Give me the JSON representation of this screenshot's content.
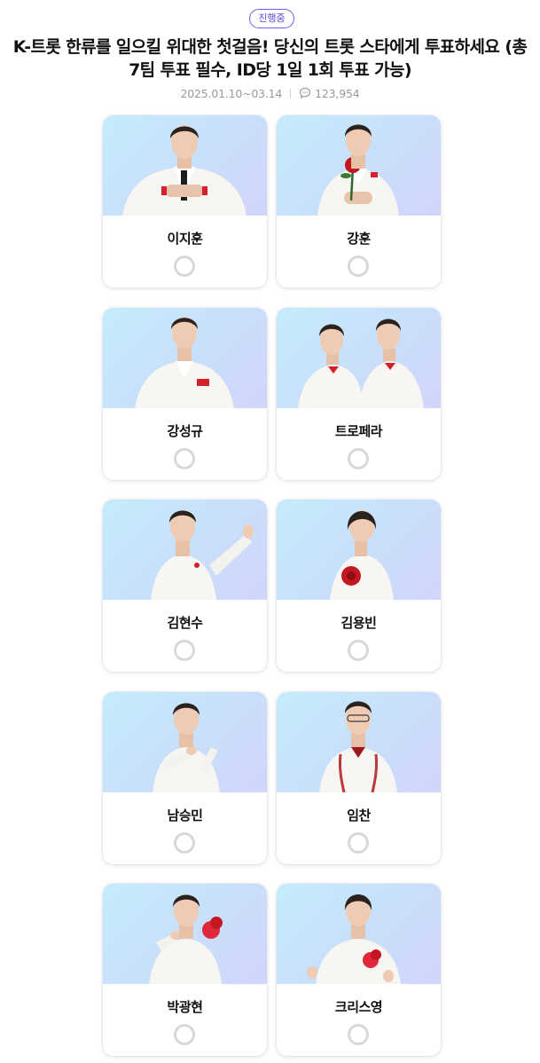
{
  "status_badge": "진행중",
  "title": "K-트롯 한류를 일으킬 위대한 첫걸음! 당신의 트롯 스타에게 투표하세요 (총 7팀 투표 필수, ID당 1일 1회 투표 가능)",
  "period": "2025.01.10~03.14",
  "comment_count": "123,954",
  "comment_icon": "speech-bubble-icon",
  "colors": {
    "accent": "#5a45e6",
    "photo_bg": "#c9dffb",
    "radio_border": "#d8d8d8"
  },
  "candidates": [
    {
      "name": "이지훈",
      "selected": false
    },
    {
      "name": "강훈",
      "selected": false
    },
    {
      "name": "강성규",
      "selected": false
    },
    {
      "name": "트로페라",
      "selected": false
    },
    {
      "name": "김현수",
      "selected": false
    },
    {
      "name": "김용빈",
      "selected": false
    },
    {
      "name": "남승민",
      "selected": false
    },
    {
      "name": "임찬",
      "selected": false
    },
    {
      "name": "박광현",
      "selected": false
    },
    {
      "name": "크리스영",
      "selected": false
    }
  ]
}
